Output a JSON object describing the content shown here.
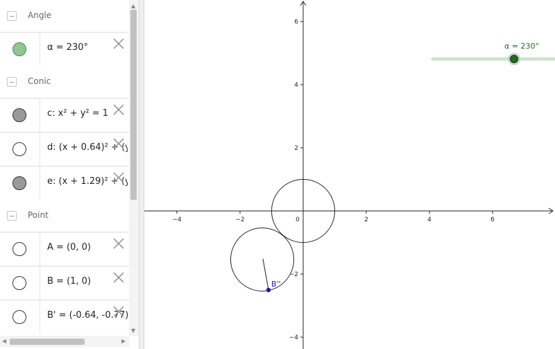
{
  "algebra": {
    "groups": [
      {
        "title": "Angle",
        "items": [
          {
            "text": "α = 230°",
            "marble": "green"
          }
        ]
      },
      {
        "title": "Conic",
        "items": [
          {
            "text": "c: x² + y² = 1",
            "marble": "gray"
          },
          {
            "text": "d: (x + 0.64)² + (y",
            "marble": "empty"
          },
          {
            "text": "e: (x + 1.29)² + (y",
            "marble": "gray"
          }
        ]
      },
      {
        "title": "Point",
        "items": [
          {
            "text": "A = (0, 0)",
            "marble": "empty"
          },
          {
            "text": "B = (1, 0)",
            "marble": "empty"
          },
          {
            "text": "B' = (-0.64, -0.77)",
            "marble": "empty"
          }
        ]
      }
    ]
  },
  "graphics": {
    "x_ticks": [
      "−4",
      "−2",
      "0",
      "2",
      "4",
      "6"
    ],
    "y_ticks": [
      "6",
      "4",
      "2",
      "−2",
      "−4"
    ],
    "slider": {
      "label": "α = 230°",
      "color": "#1f6b1f",
      "track_color": "#cfe3cf"
    },
    "point_label": "B''",
    "point_color": "#1a1aa6"
  }
}
